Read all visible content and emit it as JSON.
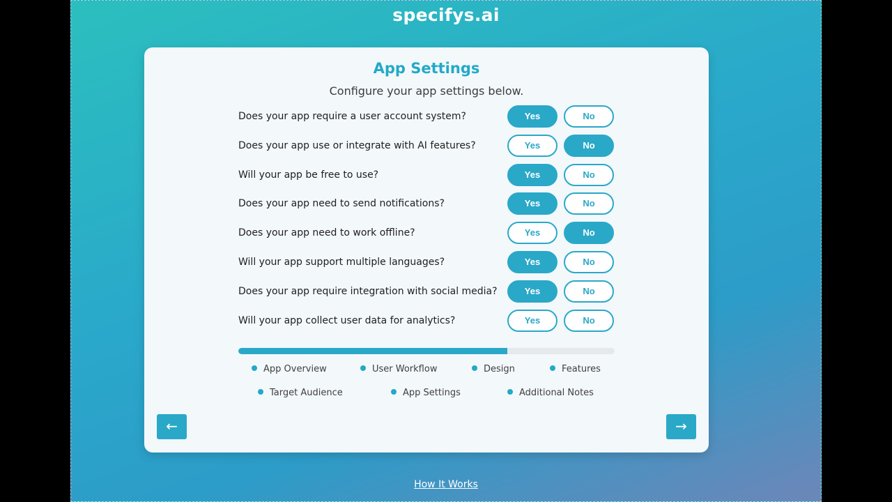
{
  "brand": "specifys.ai",
  "card": {
    "title": "App Settings",
    "subtitle": "Configure your app settings below."
  },
  "options": {
    "yes": "Yes",
    "no": "No"
  },
  "questions": [
    {
      "text": "Does your app require a user account system?",
      "selected": "yes"
    },
    {
      "text": "Does your app use or integrate with AI features?",
      "selected": "no"
    },
    {
      "text": "Will your app be free to use?",
      "selected": "yes"
    },
    {
      "text": "Does your app need to send notifications?",
      "selected": "yes"
    },
    {
      "text": "Does your app need to work offline?",
      "selected": "no"
    },
    {
      "text": "Will your app support multiple languages?",
      "selected": "yes"
    },
    {
      "text": "Does your app require integration with social media?",
      "selected": "yes"
    },
    {
      "text": "Will your app collect user data for analytics?",
      "selected": "none"
    }
  ],
  "progress": {
    "fraction": 0.714
  },
  "steps": [
    {
      "label": "App Overview"
    },
    {
      "label": "User Workflow"
    },
    {
      "label": "Design"
    },
    {
      "label": "Features"
    },
    {
      "label": "Target Audience"
    },
    {
      "label": "App Settings"
    },
    {
      "label": "Additional Notes"
    }
  ],
  "nav": {
    "prev_icon": "←",
    "next_icon": "→"
  },
  "footer": {
    "link": "How It Works"
  },
  "colors": {
    "accent": "#2aa8c8",
    "title": "#23a9c7",
    "card_bg": "#f3f8fb"
  },
  "icons": {
    "prev": "arrow-left-icon",
    "next": "arrow-right-icon",
    "step_marker": "dot-icon"
  }
}
